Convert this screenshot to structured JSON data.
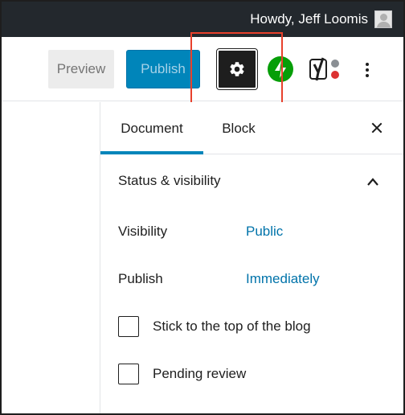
{
  "admin_bar": {
    "greeting": "Howdy, Jeff Loomis"
  },
  "toolbar": {
    "preview_label": "Preview",
    "publish_label": "Publish",
    "settings_icon": "gear-icon",
    "jetpack_icon": "jetpack-bolt-icon",
    "yoast_icon": "yoast-icon",
    "more_icon": "more-vertical-icon",
    "colors": {
      "publish_bg": "#0085ba",
      "settings_bg": "#1e1e1e",
      "jetpack_green": "#069e08",
      "highlight": "#e8412c"
    }
  },
  "sidebar": {
    "tabs": [
      {
        "label": "Document",
        "active": true
      },
      {
        "label": "Block",
        "active": false
      }
    ],
    "close_icon": "close-icon",
    "panel": {
      "title": "Status & visibility",
      "expanded": true,
      "rows": [
        {
          "label": "Visibility",
          "value": "Public"
        },
        {
          "label": "Publish",
          "value": "Immediately"
        }
      ],
      "checkboxes": [
        {
          "label": "Stick to the top of the blog",
          "checked": false
        },
        {
          "label": "Pending review",
          "checked": false
        }
      ]
    }
  }
}
